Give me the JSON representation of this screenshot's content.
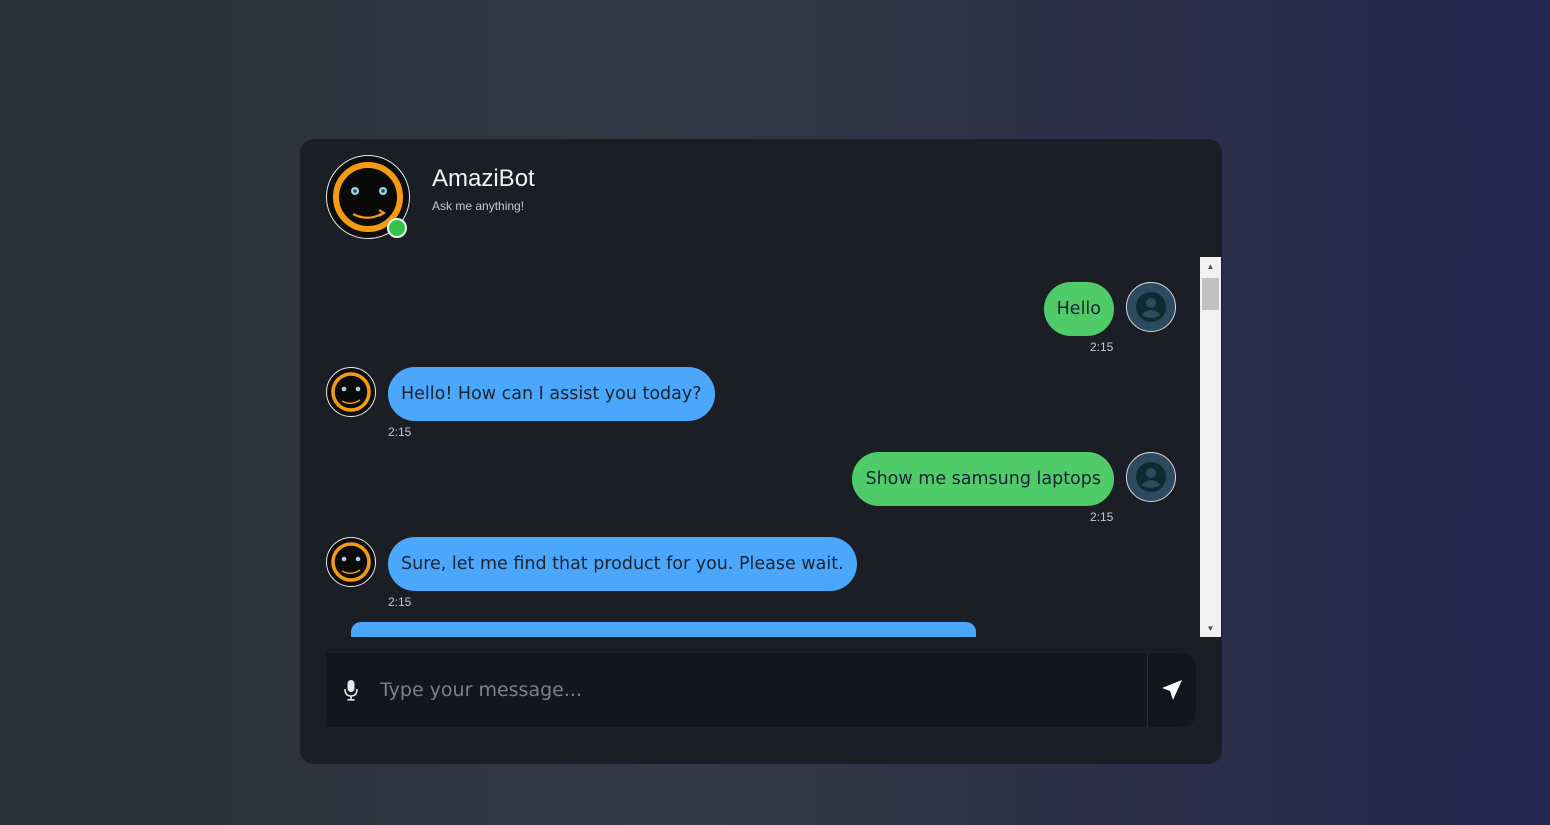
{
  "bot": {
    "name": "AmaziBot",
    "subtitle": "Ask me anything!"
  },
  "messages": [
    {
      "sender": "user",
      "text": "Hello",
      "time": "2:15"
    },
    {
      "sender": "bot",
      "text": "Hello! How can I assist you today?",
      "time": "2:15"
    },
    {
      "sender": "user",
      "text": "Show me samsung laptops",
      "time": "2:15"
    },
    {
      "sender": "bot",
      "text": "Sure, let me find that product for you. Please wait.",
      "time": "2:15"
    }
  ],
  "input": {
    "placeholder": "Type your message..."
  },
  "colors": {
    "user_bubble": "#4fcb6a",
    "bot_bubble": "#4aa7fb",
    "online": "#35c24a",
    "bot_ring": "#f39c12"
  },
  "icons": {
    "mic": "microphone-icon",
    "send": "send-icon",
    "user_avatar": "user-icon"
  }
}
